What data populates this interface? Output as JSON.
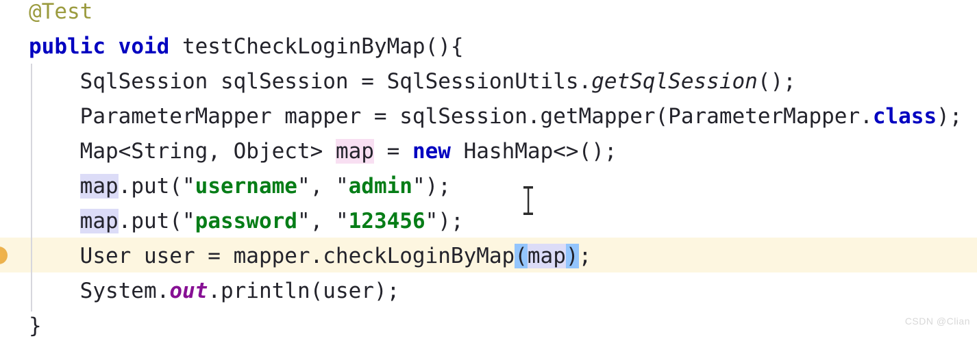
{
  "editor": {
    "language": "Java",
    "background_color": "#ffffff",
    "text_color": "#23232b",
    "caret_line_color": "#fdf6e0",
    "read_highlight_color": "#dcdcf7",
    "write_highlight_color": "#f8dff2",
    "brace_match_color": "#93c5fd",
    "keyword_color": "#0000c0",
    "string_color": "#067d17",
    "annotation_color": "#9b9b3f",
    "static_field_color": "#871094",
    "indent_guide_color": "#d6d6dd",
    "gutter_marker_color": "#e8a534"
  },
  "code": {
    "line1": {
      "annotation": "@Test"
    },
    "line2": {
      "kw_public": "public",
      "space1": " ",
      "kw_void": "void",
      "space2": " ",
      "signature": "testCheckLoginByMap(){"
    },
    "line3": {
      "indent": "    ",
      "decl": "SqlSession sqlSession = SqlSessionUtils.",
      "method": "getSqlSession",
      "tail": "();"
    },
    "line4": {
      "indent": "    ",
      "decl": "ParameterMapper mapper = sqlSession.getMapper(ParameterMapper.",
      "kw_class": "class",
      "tail": ");"
    },
    "line5": {
      "indent": "    ",
      "decl": "Map<String, Object> ",
      "var": "map",
      "mid": " = ",
      "kw_new": "new",
      "tail": " HashMap<>();"
    },
    "line6": {
      "indent": "    ",
      "var": "map",
      "call": ".put(",
      "q1": "\"",
      "str1": "username",
      "q2": "\"",
      "comma": ", ",
      "q3": "\"",
      "str2": "admin",
      "q4": "\"",
      "tail": ");"
    },
    "line7": {
      "indent": "    ",
      "var": "map",
      "call": ".put(",
      "q1": "\"",
      "str1": "password",
      "q2": "\"",
      "comma": ", ",
      "q3": "\"",
      "str2": "123456",
      "q4": "\"",
      "tail": ");"
    },
    "line8": {
      "indent": "    ",
      "decl": "User user = mapper.checkLoginByMap",
      "paren_open": "(",
      "arg": "map",
      "paren_close": ")",
      "tail": ";"
    },
    "line9": {
      "indent": "    ",
      "obj": "System.",
      "field": "out",
      "tail": ".println(user);"
    },
    "line10": {
      "brace": "}"
    }
  },
  "overlay": {
    "mouse_cursor": "text-ibeam-cursor",
    "watermark": "CSDN @Clian"
  }
}
